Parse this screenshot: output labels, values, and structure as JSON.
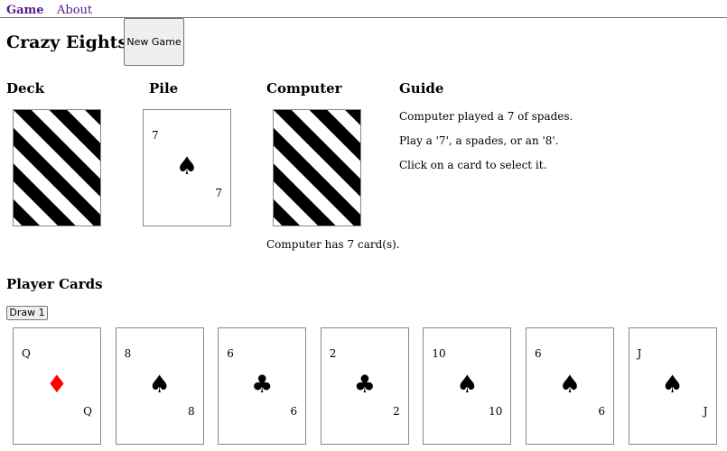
{
  "nav": {
    "game": "Game",
    "about": "About"
  },
  "title": "Crazy Eights",
  "new_game_label": "New Game",
  "deck": {
    "title": "Deck",
    "card_back": "striped-card-back"
  },
  "pile": {
    "title": "Pile",
    "card": {
      "rank": "7",
      "suit": "♠",
      "suit_name": "spades",
      "color": "#000000"
    }
  },
  "computer": {
    "title": "Computer",
    "card_back": "striped-card-back",
    "count_text": "Computer has 7 card(s)."
  },
  "guide": {
    "title": "Guide",
    "lines": [
      "Computer played a 7 of spades.",
      "Play a '7', a spades, or an '8'.",
      "Click on a card to select it."
    ]
  },
  "player": {
    "title": "Player Cards",
    "draw_label": "Draw 1",
    "cards": [
      {
        "rank": "Q",
        "suit": "♦",
        "suit_name": "diamonds",
        "color": "#ff0000"
      },
      {
        "rank": "8",
        "suit": "♠",
        "suit_name": "spades",
        "color": "#000000"
      },
      {
        "rank": "6",
        "suit": "♣",
        "suit_name": "clubs",
        "color": "#000000"
      },
      {
        "rank": "2",
        "suit": "♣",
        "suit_name": "clubs",
        "color": "#000000"
      },
      {
        "rank": "10",
        "suit": "♠",
        "suit_name": "spades",
        "color": "#000000"
      },
      {
        "rank": "6",
        "suit": "♠",
        "suit_name": "spades",
        "color": "#000000"
      },
      {
        "rank": "J",
        "suit": "♠",
        "suit_name": "spades",
        "color": "#000000"
      }
    ]
  }
}
